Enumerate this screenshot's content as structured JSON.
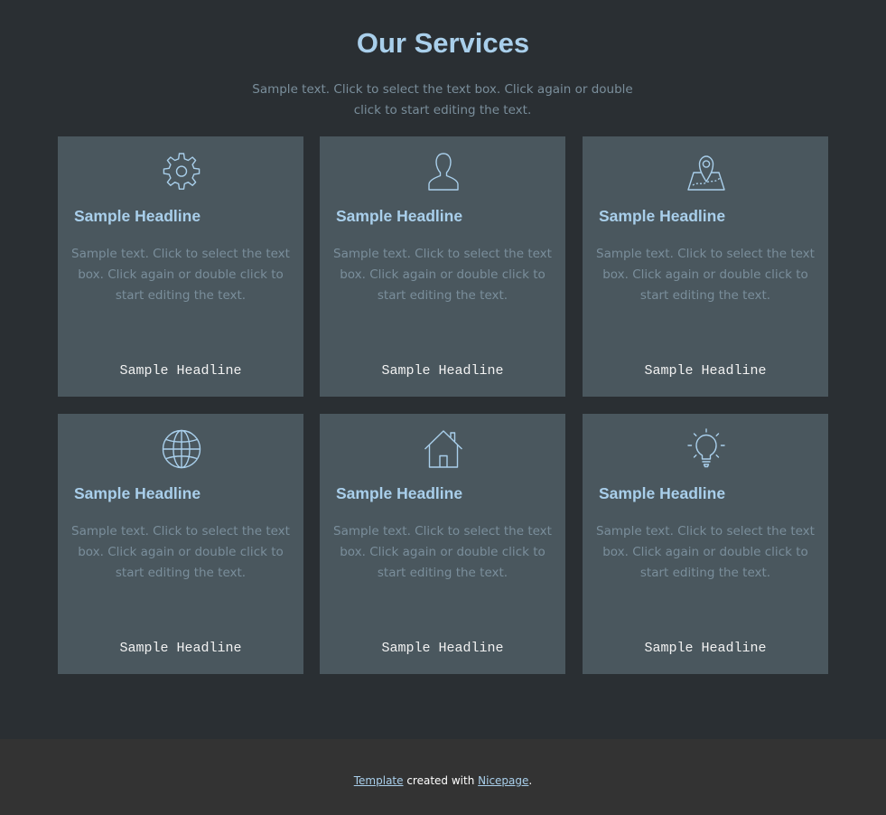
{
  "services": {
    "title": "Our Services",
    "subtitle": "Sample text. Click to select the text box. Click again or double click to start editing the text.",
    "cards": [
      {
        "icon": "gear-icon",
        "headline": "Sample Headline",
        "text": "Sample text. Click to select the text box. Click again or double click to start editing the text.",
        "link": "Sample Headline"
      },
      {
        "icon": "user-icon",
        "headline": "Sample Headline",
        "text": "Sample text. Click to select the text box. Click again or double click to start editing the text.",
        "link": "Sample Headline"
      },
      {
        "icon": "map-pin-icon",
        "headline": "Sample Headline",
        "text": "Sample text. Click to select the text box. Click again or double click to start editing the text.",
        "link": "Sample Headline"
      },
      {
        "icon": "globe-icon",
        "headline": "Sample Headline",
        "text": "Sample text. Click to select the text box. Click again or double click to start editing the text.",
        "link": "Sample Headline"
      },
      {
        "icon": "home-icon",
        "headline": "Sample Headline",
        "text": "Sample text. Click to select the text box. Click again or double click to start editing the text.",
        "link": "Sample Headline"
      },
      {
        "icon": "lightbulb-icon",
        "headline": "Sample Headline",
        "text": "Sample text. Click to select the text box. Click again or double click to start editing the text.",
        "link": "Sample Headline"
      }
    ]
  },
  "footer": {
    "template_link": "Template",
    "middle_text": " created with ",
    "nicepage_link": "Nicepage",
    "end_text": "."
  },
  "colors": {
    "page_background": "#2a2f33",
    "card_background": "#4a575e",
    "accent": "#a9cfeb",
    "muted_text": "#7a8e9b",
    "footer_background": "#333333"
  }
}
